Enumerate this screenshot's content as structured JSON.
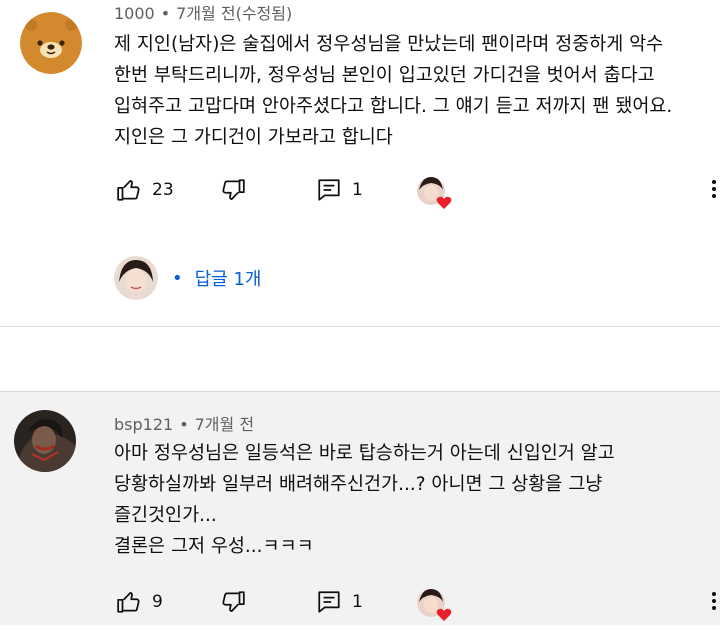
{
  "comments": [
    {
      "author": "1000",
      "time": "7개월 전(수정됨)",
      "lines": [
        "제 지인(남자)은 술집에서 정우성님을 만났는데 팬이라며 정중하게 악수",
        "한번 부탁드리니까, 정우성님 본인이 입고있던 가디건을 벗어서 춥다고",
        "입혀주고 고맙다며 안아주셨다고 합니다. 그 얘기 듣고 저까지 팬 됐어요.",
        "지인은 그 가디건이 가보라고 합니다"
      ],
      "likes": "23",
      "replies_count": "1",
      "reply_link": "답글 1개",
      "avatar_icon": "bear-face-icon"
    },
    {
      "author": "bsp121",
      "time": "7개월 전",
      "lines": [
        "아마 정우성님은 일등석은 바로 탑승하는거 아는데 신입인거 알고",
        "당황하실까봐 일부러 배려해주신건가...? 아니면 그 상황을 그냥",
        "즐긴것인가...",
        "결론은 그저 우성...ㅋㅋㅋ"
      ],
      "likes": "9",
      "replies_count": "1",
      "avatar_icon": "dark-portrait-avatar"
    }
  ],
  "colors": {
    "link": "#065fd4",
    "heart": "#e8202a",
    "bear": "#d38a2e"
  }
}
